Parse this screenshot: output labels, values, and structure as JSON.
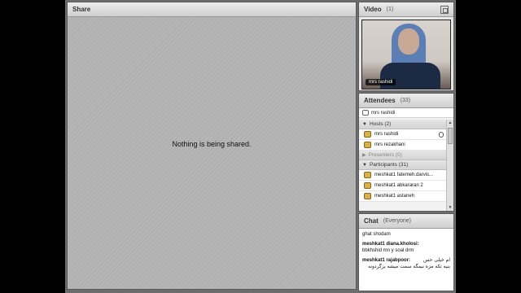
{
  "share": {
    "title": "Share",
    "message": "Nothing is being shared."
  },
  "video": {
    "title": "Video",
    "count": "(1)",
    "presenter_label": "mrs rashidi"
  },
  "attendees": {
    "title": "Attendees",
    "count": "(33)",
    "presenter": "mrs rashidi",
    "hosts": {
      "label": "Hosts (2)",
      "items": [
        {
          "name": "mrs rashidi"
        },
        {
          "name": "mrs rezakhani"
        }
      ]
    },
    "presenters": {
      "label": "Presenters (0)"
    },
    "participants": {
      "label": "Participants (31)",
      "items": [
        {
          "name": "meshkat1 fatemeh.darvis..."
        },
        {
          "name": "meshkat1 abkararan 2"
        },
        {
          "name": "meshkat1 astaneh"
        }
      ]
    }
  },
  "chat": {
    "title": "Chat",
    "scope": "(Everyone)",
    "messages": [
      {
        "sender": "",
        "text": "ghat shodam"
      },
      {
        "sender": "meshkat1 diana.kholosi:",
        "text": "bbkhshid mn y soal drm"
      },
      {
        "sender": "meshkat1 rajabpoor:",
        "text": "ام خیلی حس",
        "text2": "بنیه تکه مزه نیمگه سمت میشه برگردونه"
      }
    ]
  }
}
